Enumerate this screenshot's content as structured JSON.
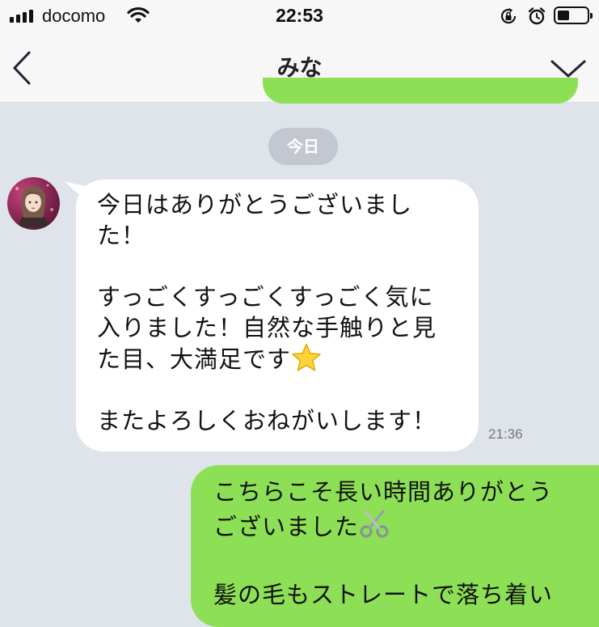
{
  "status_bar": {
    "carrier": "docomo",
    "time": "22:53",
    "icons": [
      "signal-icon",
      "wifi-icon",
      "rotation-lock-icon",
      "alarm-icon",
      "battery-icon"
    ],
    "battery_level": 0.35
  },
  "header": {
    "title": "みな",
    "back_icon": "chevron-left-icon",
    "menu_icon": "chevron-down-icon"
  },
  "chat": {
    "date_separator": "今日",
    "messages": [
      {
        "direction": "incoming",
        "lines": [
          "今日はありがとうございまし",
          "た！",
          "",
          "すっごくすっごくすっごく気に",
          "入りました！自然な手触りと見",
          "た目、大満足です"
        ],
        "emoji_1": "star-emoji",
        "last_line": "またよろしくおねがいします！",
        "time": "21:36"
      },
      {
        "direction": "outgoing",
        "line_1": "こちらこそ長い時間ありがとう",
        "line_2": "ございました",
        "emoji_1": "scissors-emoji",
        "line_4": "髪の毛もストレートで落ち着い"
      }
    ]
  },
  "colors": {
    "background": "#dfe3ea",
    "incoming_bubble": "#ffffff",
    "outgoing_bubble": "#8de055",
    "date_chip": "#c3c8d0"
  }
}
